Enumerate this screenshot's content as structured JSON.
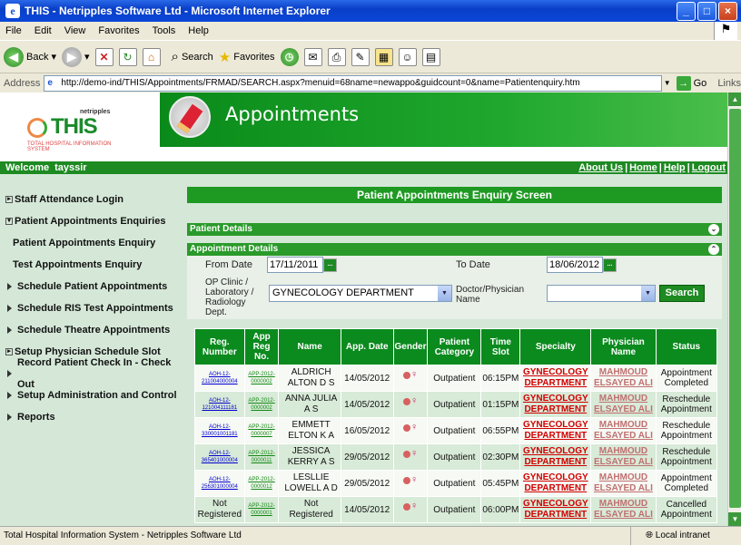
{
  "window": {
    "title": "THIS - Netripples Software Ltd - Microsoft Internet Explorer"
  },
  "menu": [
    "File",
    "Edit",
    "View",
    "Favorites",
    "Tools",
    "Help"
  ],
  "toolbar": {
    "back": "Back",
    "search": "Search",
    "favorites": "Favorites"
  },
  "address": {
    "label": "Address",
    "url": "http://demo-ind/THIS/Appointments/FRMAD/SEARCH.aspx?menuid=68name=newappo&guidcount=0&name=Patientenquiry.htm",
    "go": "Go",
    "links": "Links"
  },
  "header": {
    "logo_brand": "netripples",
    "logo_name": "THIS",
    "logo_sub": "TOTAL HOSPITAL INFORMATION SYSTEM",
    "module_title": "Appointments"
  },
  "welcome": {
    "label": "Welcome",
    "user": "tayssir"
  },
  "topnav": [
    "About Us",
    "Home",
    "Help",
    "Logout"
  ],
  "sidebar": [
    {
      "label": "Staff Attendance Login",
      "type": "box"
    },
    {
      "label": "Patient Appointments Enquiries",
      "type": "open"
    },
    {
      "label": "Patient Appointments Enquiry",
      "type": "sub"
    },
    {
      "label": "Test Appointments Enquiry",
      "type": "sub"
    },
    {
      "label": "Schedule Patient Appointments",
      "type": "tri"
    },
    {
      "label": "Schedule RIS Test Appointments",
      "type": "tri"
    },
    {
      "label": "Schedule Theatre Appointments",
      "type": "tri"
    },
    {
      "label": "Setup Physician Schedule Slot",
      "type": "box"
    },
    {
      "label": "Record Patient Check In - Check Out",
      "type": "tri"
    },
    {
      "label": "Setup Administration and Control",
      "type": "tri"
    },
    {
      "label": "Reports",
      "type": "tri"
    }
  ],
  "main": {
    "screen_title": "Patient Appointments Enquiry Screen",
    "patient_details": "Patient Details",
    "appointment_details": "Appointment Details",
    "from_date_label": "From Date",
    "from_date": "17/11/2011",
    "to_date_label": "To Date",
    "to_date": "18/06/2012",
    "clinic_label": "OP Clinic / Laboratory / Radiology Dept.",
    "clinic_value": "GYNECOLOGY DEPARTMENT",
    "doctor_label": "Doctor/Physician Name",
    "doctor_value": "",
    "search_label": "Search"
  },
  "table": {
    "headers": [
      "Reg. Number",
      "App Reg No.",
      "Name",
      "App. Date",
      "Gender",
      "Patient Category",
      "Time Slot",
      "Specialty",
      "Physician Name",
      "Status"
    ],
    "rows": [
      {
        "reg": "AOH-12-211004000004",
        "app": "APP-2012-0000002",
        "name": "ALDRICH ALTON D S",
        "date": "14/05/2012",
        "category": "Outpatient",
        "time": "06:15PM",
        "specialty": "GYNECOLOGY DEPARTMENT",
        "physician": "MAHMOUD ELSAYED ALI",
        "status": "Appointment Completed"
      },
      {
        "reg": "AOH-12-121004111181",
        "app": "APP-2012-0000002",
        "name": "ANNA JULIA A S",
        "date": "14/05/2012",
        "category": "Outpatient",
        "time": "01:15PM",
        "specialty": "GYNECOLOGY DEPARTMENT",
        "physician": "MAHMOUD ELSAYED ALI",
        "status": "Reschedule Appointment"
      },
      {
        "reg": "AOH-12-330001001181",
        "app": "APP-2012-0000007",
        "name": "EMMETT ELTON K A",
        "date": "16/05/2012",
        "category": "Outpatient",
        "time": "06:55PM",
        "specialty": "GYNECOLOGY DEPARTMENT",
        "physician": "MAHMOUD ELSAYED ALI",
        "status": "Reschedule Appointment"
      },
      {
        "reg": "AOH-12-365401000004",
        "app": "APP-2012-0000011",
        "name": "JESSICA KERRY A S",
        "date": "29/05/2012",
        "category": "Outpatient",
        "time": "02:30PM",
        "specialty": "GYNECOLOGY DEPARTMENT",
        "physician": "MAHMOUD ELSAYED ALI",
        "status": "Reschedule Appointment"
      },
      {
        "reg": "AOH-12-256301000004",
        "app": "APP-2012-0000012",
        "name": "LESLLIE LOWELL A D",
        "date": "29/05/2012",
        "category": "Outpatient",
        "time": "05:45PM",
        "specialty": "GYNECOLOGY DEPARTMENT",
        "physician": "MAHMOUD ELSAYED ALI",
        "status": "Appointment Completed"
      },
      {
        "reg": "Not Registered",
        "app": "APP-2012-0000001",
        "name": "Not Registered",
        "date": "14/05/2012",
        "category": "Outpatient",
        "time": "06:00PM",
        "specialty": "GYNECOLOGY DEPARTMENT",
        "physician": "MAHMOUD ELSAYED ALI",
        "status": "Cancelled Appointment"
      }
    ]
  },
  "statusbar": {
    "left": "Total Hospital Information System - Netripples Software Ltd",
    "zone": "Local intranet"
  },
  "colors": {
    "brand_green": "#1e9a22",
    "header_green": "#0b8a1e",
    "specialty_red": "#d10000"
  }
}
